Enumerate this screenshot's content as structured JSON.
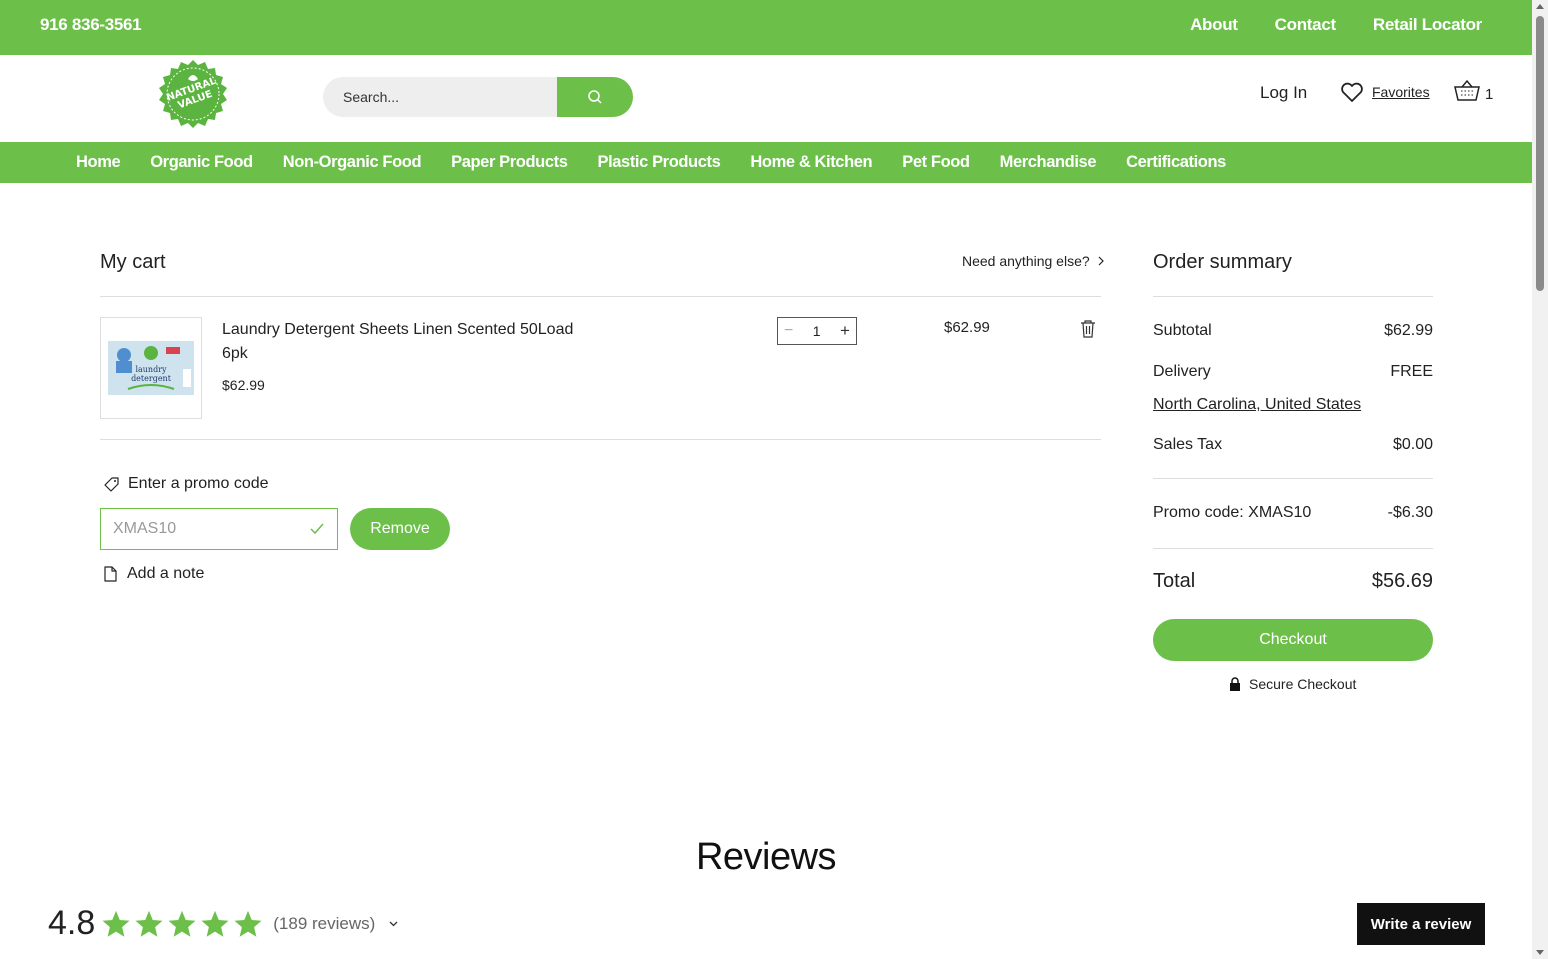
{
  "topbar": {
    "phone": "916 836-3561",
    "links": [
      "About",
      "Contact",
      "Retail Locator"
    ]
  },
  "header": {
    "search_placeholder": "Search...",
    "login": "Log In",
    "favorites": "Favorites",
    "cart_count": "1"
  },
  "nav": [
    "Home",
    "Organic Food",
    "Non-Organic Food",
    "Paper Products",
    "Plastic Products",
    "Home & Kitchen",
    "Pet Food",
    "Merchandise",
    "Certifications"
  ],
  "cart": {
    "title": "My cart",
    "need_more": "Need anything else?",
    "item": {
      "name": "Laundry Detergent Sheets Linen Scented 50Load 6pk",
      "price": "$62.99",
      "quantity": "1",
      "line_total": "$62.99"
    },
    "promo_label": "Enter a promo code",
    "promo_value": "XMAS10",
    "remove_label": "Remove",
    "add_note": "Add a note"
  },
  "summary": {
    "title": "Order summary",
    "subtotal_label": "Subtotal",
    "subtotal": "$62.99",
    "delivery_label": "Delivery",
    "delivery": "FREE",
    "region": "North Carolina, United States",
    "tax_label": "Sales Tax",
    "tax": "$0.00",
    "promo_label": "Promo code: XMAS10",
    "promo_discount": "-$6.30",
    "total_label": "Total",
    "total": "$56.69",
    "checkout": "Checkout",
    "secure": "Secure Checkout"
  },
  "reviews": {
    "title": "Reviews",
    "score": "4.8",
    "stars": 5,
    "count": "(189 reviews)",
    "write": "Write a review"
  },
  "colors": {
    "brand_green": "#6cc04a",
    "dark": "#111111"
  }
}
